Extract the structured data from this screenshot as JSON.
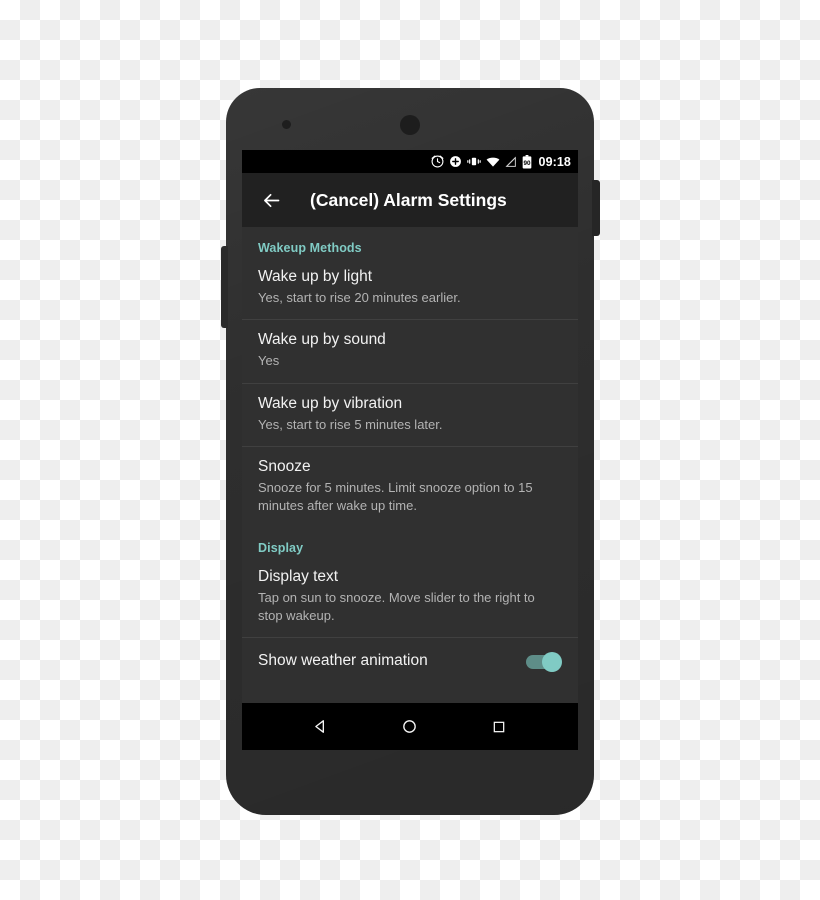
{
  "device": {
    "type": "android-smartphone",
    "body_color": "#2e2e2e",
    "accent_color": "#80cbc4"
  },
  "status_bar": {
    "time": "09:18",
    "battery_level_label": "90",
    "icons": [
      "alarm-clock-icon",
      "do-not-disturb-plus-icon",
      "vibrate-icon",
      "wifi-icon",
      "no-signal-icon",
      "battery-icon"
    ]
  },
  "toolbar": {
    "back_icon": "back-arrow-icon",
    "title": "(Cancel) Alarm Settings"
  },
  "sections": [
    {
      "header": "Wakeup Methods",
      "items": [
        {
          "title": "Wake up by light",
          "summary": "Yes, start to rise 20 minutes earlier.",
          "toggle": null
        },
        {
          "title": "Wake up by sound",
          "summary": "Yes",
          "toggle": null
        },
        {
          "title": "Wake up by vibration",
          "summary": "Yes, start to rise 5 minutes later.",
          "toggle": null
        },
        {
          "title": "Snooze",
          "summary": "Snooze for 5 minutes. Limit snooze option to 15 minutes after wake up time.",
          "toggle": null
        }
      ]
    },
    {
      "header": "Display",
      "items": [
        {
          "title": "Display text",
          "summary": "Tap on sun to snooze. Move slider to the right to stop wakeup.",
          "toggle": null
        },
        {
          "title": "Show weather animation",
          "summary": null,
          "toggle": "on"
        }
      ]
    }
  ],
  "nav_bar": {
    "back_label": "back-triangle-icon",
    "home_label": "home-circle-icon",
    "recents_label": "recents-square-icon"
  }
}
